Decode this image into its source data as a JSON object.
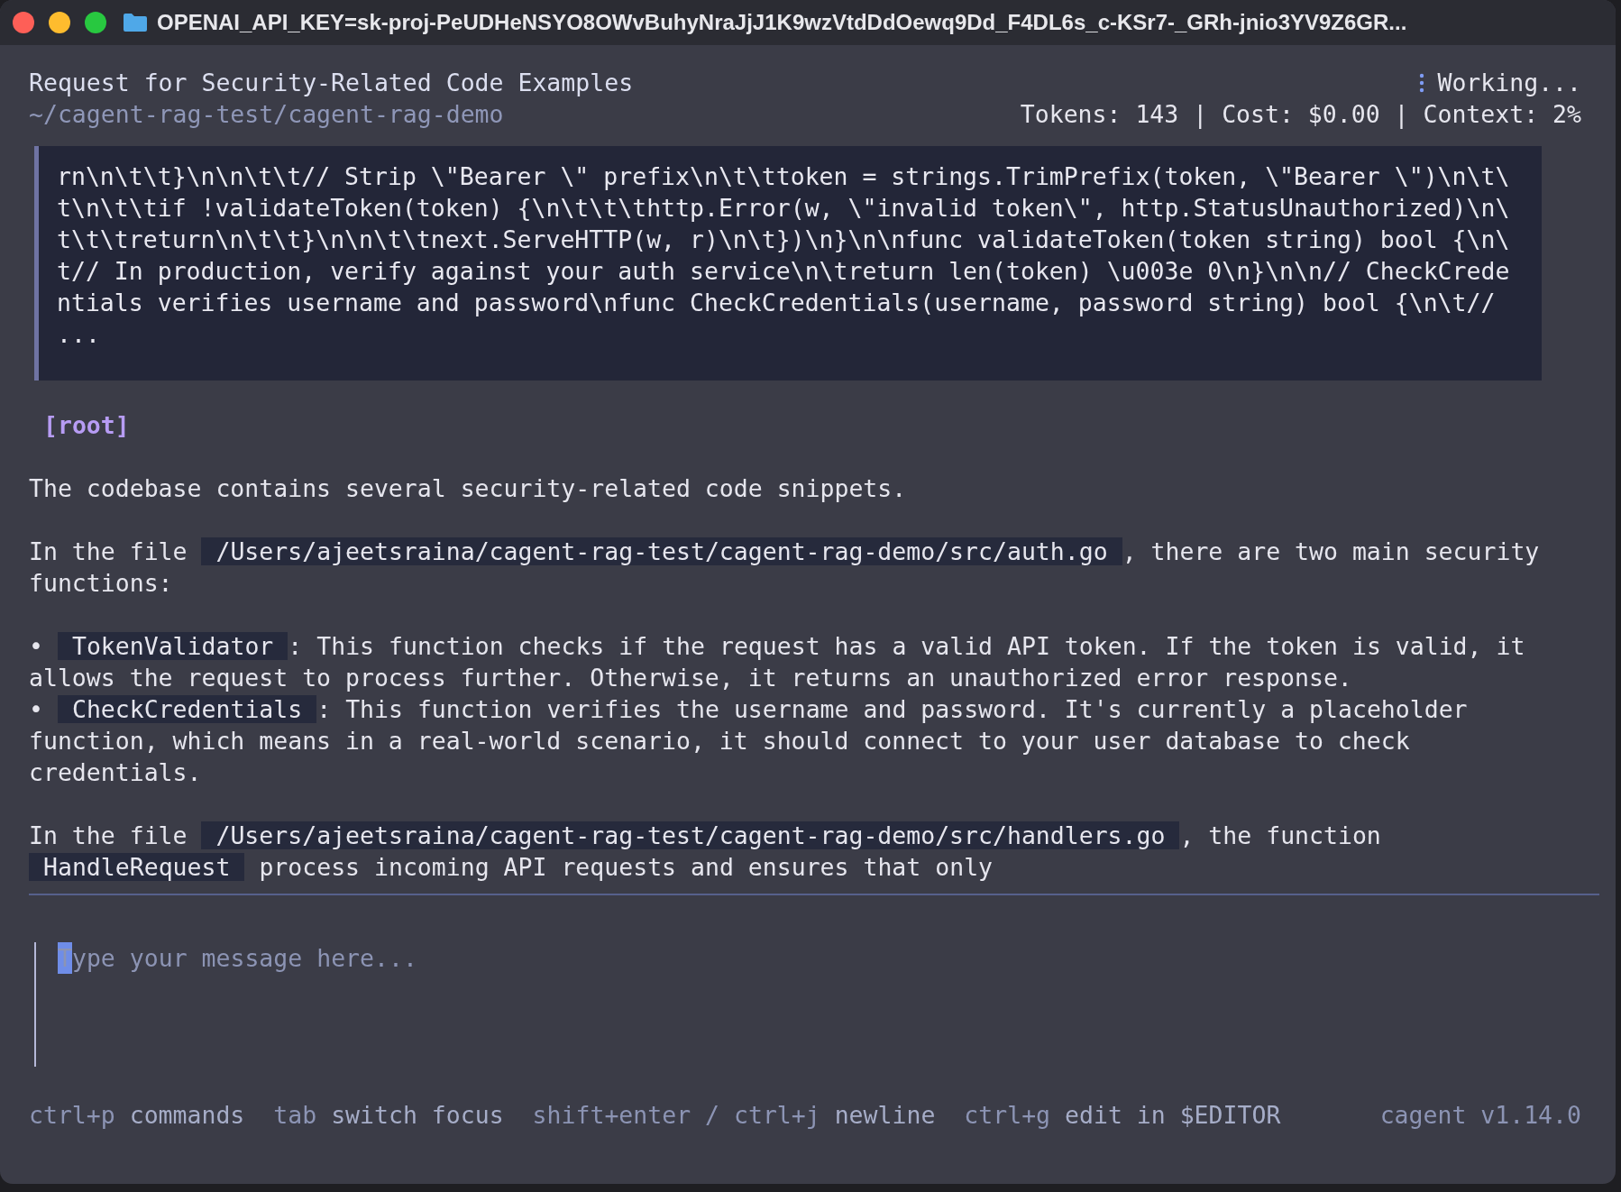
{
  "window": {
    "title": "OPENAI_API_KEY=sk-proj-PeUDHeNSYO8OWvBuhyNraJjJ1K9wzVtdDdOewq9Dd_F4DL6s_c-KSr7-_GRh-jnio3YV9Z6GR..."
  },
  "header": {
    "title": "Request for Security-Related Code Examples",
    "path": "~/cagent-rag-test/cagent-rag-demo",
    "status": "Working...",
    "stats": "Tokens: 143 | Cost: $0.00 | Context: 2%"
  },
  "code_block": {
    "lines": [
      "rn\\n\\t\\t}\\n\\n\\t\\t// Strip \\\"Bearer \\\" prefix\\n\\t\\ttoken = strings.TrimPrefix(token, \\\"Bearer \\\")\\n\\t\\",
      "t\\n\\t\\tif !validateToken(token) {\\n\\t\\t\\thttp.Error(w, \\\"invalid token\\\", http.StatusUnauthorized)\\n\\",
      "t\\t\\treturn\\n\\t\\t}\\n\\n\\t\\tnext.ServeHTTP(w, r)\\n\\t})\\n}\\n\\nfunc validateToken(token string) bool {\\n\\",
      "t// In production, verify against your auth service\\n\\treturn len(token) \\u003e 0\\n}\\n\\n// CheckCrede",
      "ntials verifies username and password\\nfunc CheckCredentials(username, password string) bool {\\n\\t//",
      "..."
    ]
  },
  "message": {
    "author": "[root]",
    "blocks": [
      {
        "kind": "para",
        "parts": [
          {
            "text": "The codebase contains several security-related code snippets.",
            "code": false
          }
        ]
      },
      {
        "kind": "para",
        "parts": [
          {
            "text": "In the file ",
            "code": false
          },
          {
            "text": "/Users/ajeetsraina/cagent-rag-test/cagent-rag-demo/src/auth.go",
            "code": true
          },
          {
            "text": ", there are two main security functions:",
            "code": false
          }
        ]
      },
      {
        "kind": "bullet",
        "bullet": "•",
        "parts": [
          {
            "text": "TokenValidator",
            "code": true
          },
          {
            "text": ": This function checks if the request has a valid API token. If the token is valid, it allows the request to process further. Otherwise, it returns an unauthorized error response.",
            "code": false
          }
        ]
      },
      {
        "kind": "bullet",
        "bullet": "•",
        "parts": [
          {
            "text": "CheckCredentials",
            "code": true
          },
          {
            "text": ": This function verifies the username and password. It's currently a placeholder function, which means in a real-world scenario, it should connect to your user database to check credentials.",
            "code": false
          }
        ]
      },
      {
        "kind": "para",
        "parts": [
          {
            "text": "In the file ",
            "code": false
          },
          {
            "text": "/Users/ajeetsraina/cagent-rag-test/cagent-rag-demo/src/handlers.go",
            "code": true
          },
          {
            "text": ", the function ",
            "code": false
          },
          {
            "text": "HandleRequest",
            "code": true
          },
          {
            "text": " process incoming API requests and ensures that only",
            "code": false
          }
        ]
      }
    ]
  },
  "input": {
    "placeholder": "Type your message here..."
  },
  "footer": {
    "hints": [
      {
        "key": "ctrl+p",
        "label": "commands"
      },
      {
        "key": "tab",
        "label": "switch focus"
      },
      {
        "key": "shift+enter / ctrl+j",
        "label": "newline"
      },
      {
        "key": "ctrl+g",
        "label": "edit in $EDITOR"
      }
    ],
    "version": "cagent v1.14.0"
  }
}
